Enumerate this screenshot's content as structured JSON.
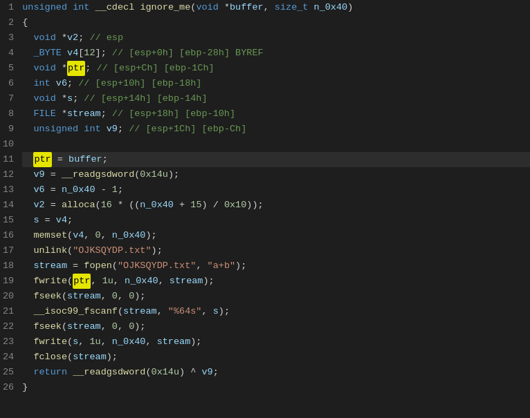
{
  "lines": [
    {
      "num": 1,
      "highlighted": false
    },
    {
      "num": 2,
      "highlighted": false
    },
    {
      "num": 3,
      "highlighted": false
    },
    {
      "num": 4,
      "highlighted": false
    },
    {
      "num": 5,
      "highlighted": false
    },
    {
      "num": 6,
      "highlighted": false
    },
    {
      "num": 7,
      "highlighted": false
    },
    {
      "num": 8,
      "highlighted": false
    },
    {
      "num": 9,
      "highlighted": false
    },
    {
      "num": 10,
      "highlighted": false
    },
    {
      "num": 11,
      "highlighted": true
    },
    {
      "num": 12,
      "highlighted": false
    },
    {
      "num": 13,
      "highlighted": false
    },
    {
      "num": 14,
      "highlighted": false
    },
    {
      "num": 15,
      "highlighted": false
    },
    {
      "num": 16,
      "highlighted": false
    },
    {
      "num": 17,
      "highlighted": false
    },
    {
      "num": 18,
      "highlighted": false
    },
    {
      "num": 19,
      "highlighted": false
    },
    {
      "num": 20,
      "highlighted": false
    },
    {
      "num": 21,
      "highlighted": false
    },
    {
      "num": 22,
      "highlighted": false
    },
    {
      "num": 23,
      "highlighted": false
    },
    {
      "num": 24,
      "highlighted": false
    },
    {
      "num": 25,
      "highlighted": false
    },
    {
      "num": 26,
      "highlighted": false
    }
  ]
}
